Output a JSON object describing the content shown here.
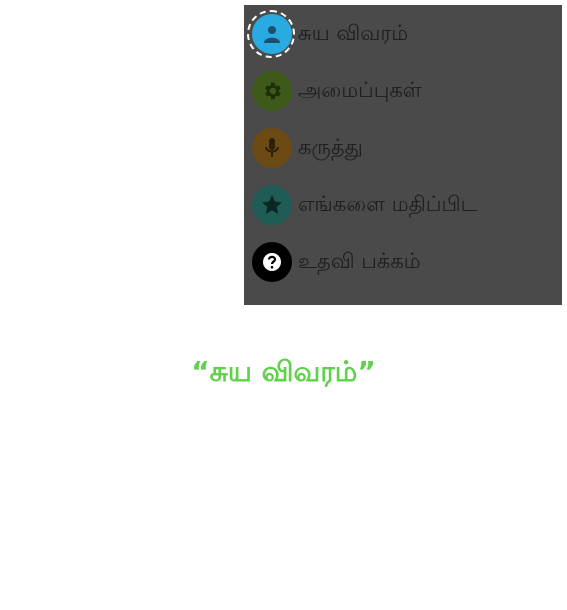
{
  "menu": {
    "items": [
      {
        "label": "சுய விவரம்",
        "icon": "user-icon",
        "color": "#29abe2"
      },
      {
        "label": "அமைப்புகள்",
        "icon": "gear-icon",
        "color": "#3d5a18"
      },
      {
        "label": " கருத்து",
        "icon": "microphone-icon",
        "color": "#6b4a14"
      },
      {
        "label": "எங்களை மதிப்பிட",
        "icon": "star-icon",
        "color": "#1f5c55"
      },
      {
        "label": "உதவி பக்கம்",
        "icon": "question-icon",
        "color": "#000000"
      }
    ],
    "highlighted_index": 0
  },
  "caption": {
    "text": "“சுய  விவரம்”",
    "color": "#5fd14a"
  }
}
